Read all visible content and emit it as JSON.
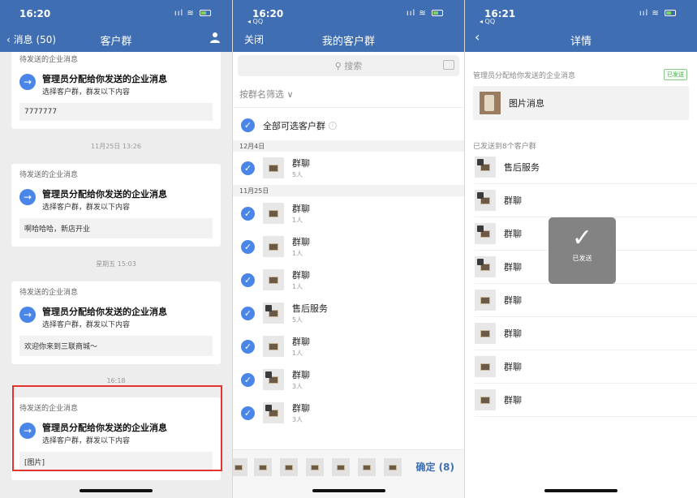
{
  "screen1": {
    "status_time": "16:20",
    "back_label": "消息 (50)",
    "title": "客户群",
    "cards": [
      {
        "head": "待发送的企业消息",
        "title": "管理员分配给你发送的企业消息",
        "sub": "选择客户群，群发以下内容",
        "content": "7777777"
      },
      {
        "head": "待发送的企业消息",
        "title": "管理员分配给你发送的企业消息",
        "sub": "选择客户群，群发以下内容",
        "content": "啊哈哈哈，新店开业"
      },
      {
        "head": "待发送的企业消息",
        "title": "管理员分配给你发送的企业消息",
        "sub": "选择客户群，群发以下内容",
        "content": "欢迎你来到三联商城～"
      },
      {
        "head": "待发送的企业消息",
        "title": "管理员分配给你发送的企业消息",
        "sub": "选择客户群，群发以下内容",
        "content": "[图片]"
      }
    ],
    "times": [
      "11月25日 13:26",
      "星期五 15:03",
      "16:18"
    ]
  },
  "screen2": {
    "status_time": "16:20",
    "status_sub": "◂ QQ",
    "close_label": "关闭",
    "title": "我的客户群",
    "search_placeholder": "搜索",
    "filter_label": "按群名筛选 ∨",
    "select_all_label": "全部可选客户群",
    "dates": [
      "12月4日",
      "11月25日"
    ],
    "groups": [
      {
        "name": "群聊",
        "count": "5人"
      },
      {
        "name": "群聊",
        "count": "1人"
      },
      {
        "name": "群聊",
        "count": "1人"
      },
      {
        "name": "群聊",
        "count": "1人"
      },
      {
        "name": "售后服务",
        "count": "5人"
      },
      {
        "name": "群聊",
        "count": "1人"
      },
      {
        "name": "群聊",
        "count": "3人"
      },
      {
        "name": "群聊",
        "count": "3人"
      }
    ],
    "confirm_label": "确定 (8)"
  },
  "screen3": {
    "status_time": "16:21",
    "status_sub": "◂ QQ",
    "title": "详情",
    "msg_label": "管理员分配给你发送的企业消息",
    "sent_badge": "已发送",
    "msg_text": "图片消息",
    "sent_to_label": "已发送到8个客户群",
    "rows": [
      "售后服务",
      "群聊",
      "群聊",
      "群聊",
      "群聊",
      "群聊",
      "群聊",
      "群聊"
    ],
    "toast_text": "已发送"
  },
  "colors": {
    "nav": "#3f6eb3",
    "accent": "#4a86e8",
    "highlight": "#e3342f"
  }
}
